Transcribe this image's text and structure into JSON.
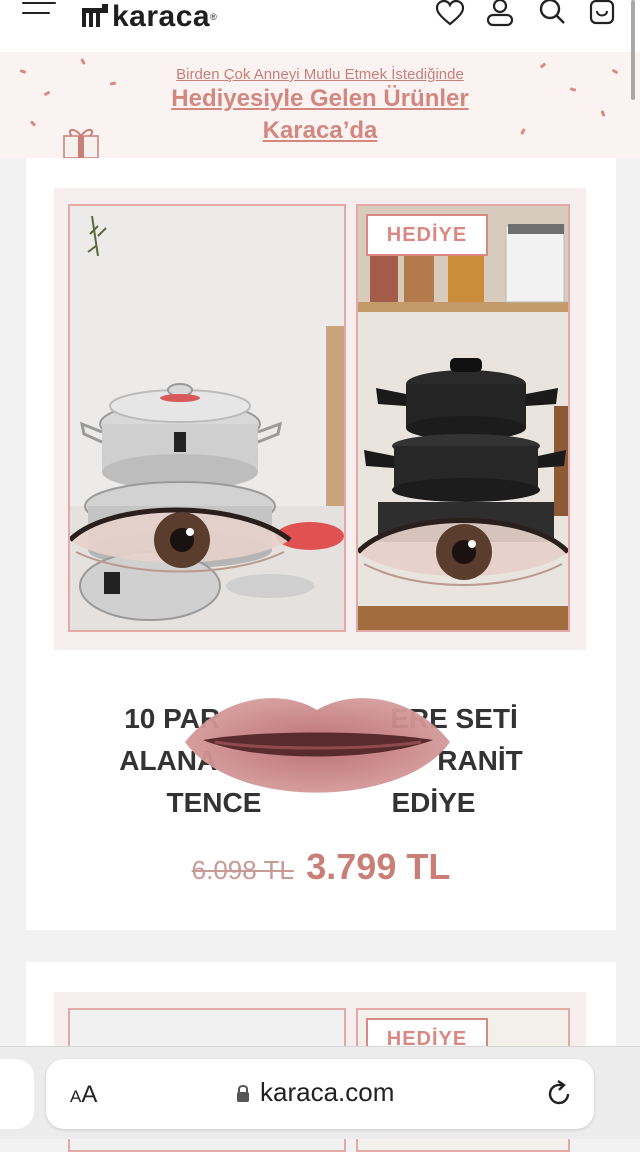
{
  "header": {
    "menu_icon": "hamburger-icon",
    "brand": "karaca",
    "brand_mark": "®",
    "icons": [
      "heart-icon",
      "user-icon",
      "search-icon",
      "bag-icon"
    ]
  },
  "banner": {
    "subtitle": "Birden Çok Anneyi Mutlu Etmek İstediğinde",
    "title_line1": "Hediyesiyle Gelen Ürünler",
    "title_line2": "Karaca’da"
  },
  "product": {
    "badge": "HEDİYE",
    "title_line1": "10 PAR",
    "title_line1_end": "ERE SETİ",
    "title_line2": "ALANA",
    "title_line2_end": "RANİT",
    "title_line3": "TENCE",
    "title_line3_end": "EDİYE",
    "old_price": "6.098 TL",
    "new_price": "3.799 TL"
  },
  "product2": {
    "badge": "HEDİYE"
  },
  "browser": {
    "aa_big": "A",
    "aa_small": "A",
    "url": "karaca.com",
    "lock_icon": "lock-icon",
    "reload_icon": "reload-icon"
  },
  "colors": {
    "accent": "#d28880",
    "price": "#c97f77",
    "old_price": "#c79a96"
  }
}
